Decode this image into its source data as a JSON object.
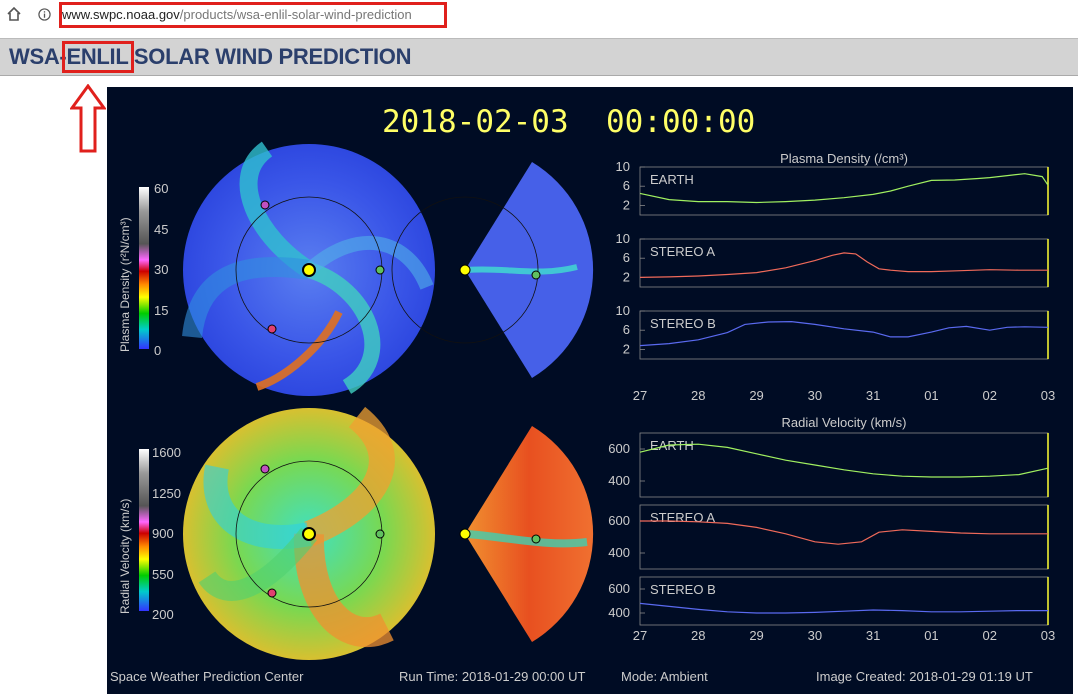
{
  "browser": {
    "url_domain": "www.swpc.noaa.gov",
    "url_path": "/products/wsa-enlil-solar-wind-prediction"
  },
  "page": {
    "title": "WSA-ENLIL SOLAR WIND PREDICTION"
  },
  "colors": {
    "highlight": "#e0201c",
    "title_text": "#2b3f6c",
    "figure_bg": "#000c24",
    "timestamp": "#ffff66",
    "earth_line": "#a0f060",
    "stereo_a_line": "#f06a5a",
    "stereo_b_line": "#5a6af0"
  },
  "figure": {
    "timestamp": "2018-02-03  00:00:00",
    "density_colorbar": {
      "label": "Plasma Density (r²N/cm³)",
      "ticks": [
        "60",
        "45",
        "30",
        "15",
        "0"
      ]
    },
    "velocity_colorbar": {
      "label": "Radial Velocity (km/s)",
      "ticks": [
        "1600",
        "1250",
        "900",
        "550",
        "200"
      ]
    },
    "footer": {
      "center": "Space Weather Prediction Center",
      "run_time": "Run Time: 2018-01-29 00:00 UT",
      "mode": "Mode: Ambient",
      "created": "Image Created: 2018-01-29 01:19 UT"
    }
  },
  "chart_data": [
    {
      "type": "line",
      "title": "Plasma Density (/cm³)",
      "x_ticks": [
        "27",
        "28",
        "29",
        "30",
        "31",
        "01",
        "02",
        "03"
      ],
      "panels": [
        {
          "name": "EARTH",
          "yticks": [
            "10",
            "6",
            "2"
          ],
          "ylim": [
            0,
            10
          ],
          "x": [
            27,
            27.5,
            28,
            28.5,
            29,
            29.5,
            30,
            30.5,
            31,
            31.3,
            31.6,
            32,
            32.4,
            32.8,
            33,
            33.3,
            33.6,
            33.9,
            34
          ],
          "y": [
            4.5,
            3.2,
            2.8,
            2.8,
            2.6,
            2.8,
            3.1,
            3.6,
            4.3,
            5.0,
            6.0,
            7.2,
            7.3,
            7.6,
            7.8,
            8.2,
            8.6,
            8.0,
            6.2
          ]
        },
        {
          "name": "STEREO A",
          "yticks": [
            "10",
            "6",
            "2"
          ],
          "ylim": [
            0,
            10
          ],
          "x": [
            27,
            27.5,
            28,
            28.5,
            29,
            29.5,
            30,
            30.3,
            30.5,
            30.7,
            30.9,
            31.1,
            31.3,
            31.6,
            32,
            32.5,
            33,
            33.5,
            34
          ],
          "y": [
            2.0,
            2.1,
            2.3,
            2.6,
            3.0,
            4.0,
            5.5,
            6.6,
            7.1,
            6.9,
            5.2,
            3.8,
            3.5,
            3.2,
            3.2,
            3.4,
            3.6,
            3.5,
            3.5
          ]
        },
        {
          "name": "STEREO B",
          "yticks": [
            "10",
            "6",
            "2"
          ],
          "ylim": [
            0,
            10
          ],
          "x": [
            27,
            27.5,
            28,
            28.5,
            28.8,
            29.2,
            29.6,
            30,
            30.5,
            31,
            31.3,
            31.6,
            32,
            32.3,
            32.6,
            33,
            33.3,
            33.6,
            34
          ],
          "y": [
            2.8,
            3.2,
            4.0,
            5.5,
            7.2,
            7.7,
            7.8,
            7.2,
            6.3,
            5.6,
            4.6,
            4.6,
            5.6,
            6.5,
            6.8,
            6.0,
            6.6,
            6.7,
            6.6
          ]
        }
      ]
    },
    {
      "type": "line",
      "title": "Radial Velocity (km/s)",
      "x_ticks": [
        "27",
        "28",
        "29",
        "30",
        "31",
        "01",
        "02",
        "03"
      ],
      "panels": [
        {
          "name": "EARTH",
          "yticks": [
            "600",
            "400"
          ],
          "ylim": [
            300,
            700
          ],
          "x": [
            27,
            27.5,
            28,
            28.5,
            29,
            29.5,
            30,
            30.5,
            31,
            31.5,
            32,
            32.5,
            33,
            33.5,
            34
          ],
          "y": [
            580,
            625,
            630,
            610,
            570,
            530,
            500,
            470,
            445,
            430,
            425,
            425,
            430,
            440,
            480
          ]
        },
        {
          "name": "STEREO A",
          "yticks": [
            "600",
            "400"
          ],
          "ylim": [
            300,
            700
          ],
          "x": [
            27,
            27.5,
            28,
            28.5,
            29,
            29.5,
            30,
            30.4,
            30.8,
            31.1,
            31.5,
            32,
            32.5,
            33,
            33.5,
            34
          ],
          "y": [
            600,
            600,
            595,
            585,
            560,
            520,
            470,
            455,
            470,
            530,
            545,
            535,
            525,
            520,
            520,
            520
          ]
        },
        {
          "name": "STEREO B",
          "yticks": [
            "600",
            "400"
          ],
          "ylim": [
            300,
            700
          ],
          "x": [
            27,
            27.5,
            28,
            28.5,
            29,
            29.5,
            30,
            30.5,
            31,
            31.5,
            32,
            32.5,
            33,
            33.5,
            34
          ],
          "y": [
            480,
            455,
            430,
            410,
            400,
            400,
            405,
            415,
            425,
            420,
            410,
            410,
            415,
            420,
            420
          ]
        }
      ]
    }
  ]
}
